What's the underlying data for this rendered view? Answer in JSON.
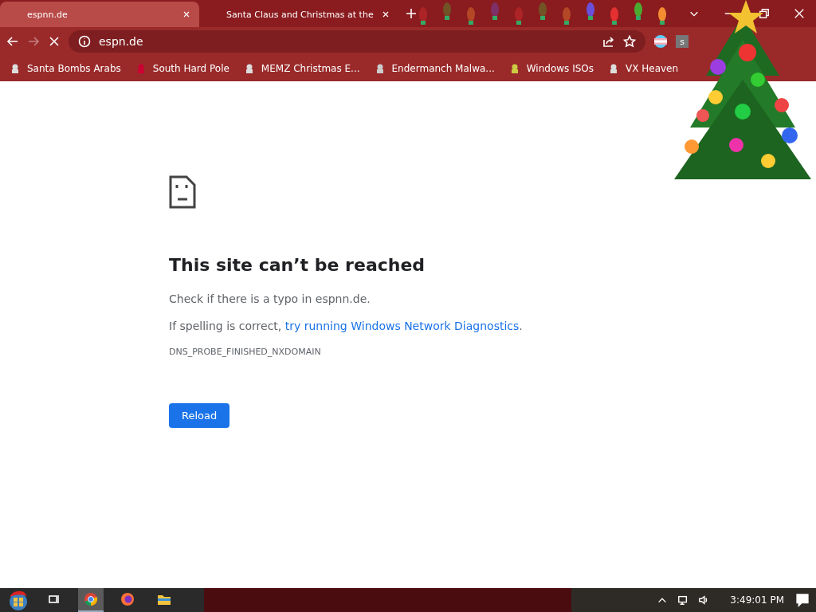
{
  "tabs": [
    {
      "title": "espnn.de",
      "selected": true
    },
    {
      "title": "Santa Claus and Christmas at the",
      "selected": false
    }
  ],
  "toolbar": {
    "address": "espn.de",
    "loading": true,
    "extension_letter": "s"
  },
  "bookmarks": [
    {
      "label": "Santa Bombs Arabs"
    },
    {
      "label": "South Hard Pole"
    },
    {
      "label": "MEMZ Christmas E..."
    },
    {
      "label": "Endermanch Malwa..."
    },
    {
      "label": "Windows ISOs"
    },
    {
      "label": "VX Heaven"
    }
  ],
  "error_page": {
    "title": "This site can’t be reached",
    "hint": "Check if there is a typo in espnn.de.",
    "suggestion": "If spelling is correct,",
    "link": "try running Windows Network Diagnostics",
    "link_end": ".",
    "code": "DNS_PROBE_FINISHED_NXDOMAIN",
    "button": "Reload"
  },
  "taskbar": {
    "apps": [
      {
        "kind": "taskview",
        "selected": false
      },
      {
        "kind": "chrome",
        "selected": true
      },
      {
        "kind": "firefox",
        "selected": false
      },
      {
        "kind": "explorer",
        "selected": false
      }
    ],
    "clock": "3:49:01 PM"
  }
}
